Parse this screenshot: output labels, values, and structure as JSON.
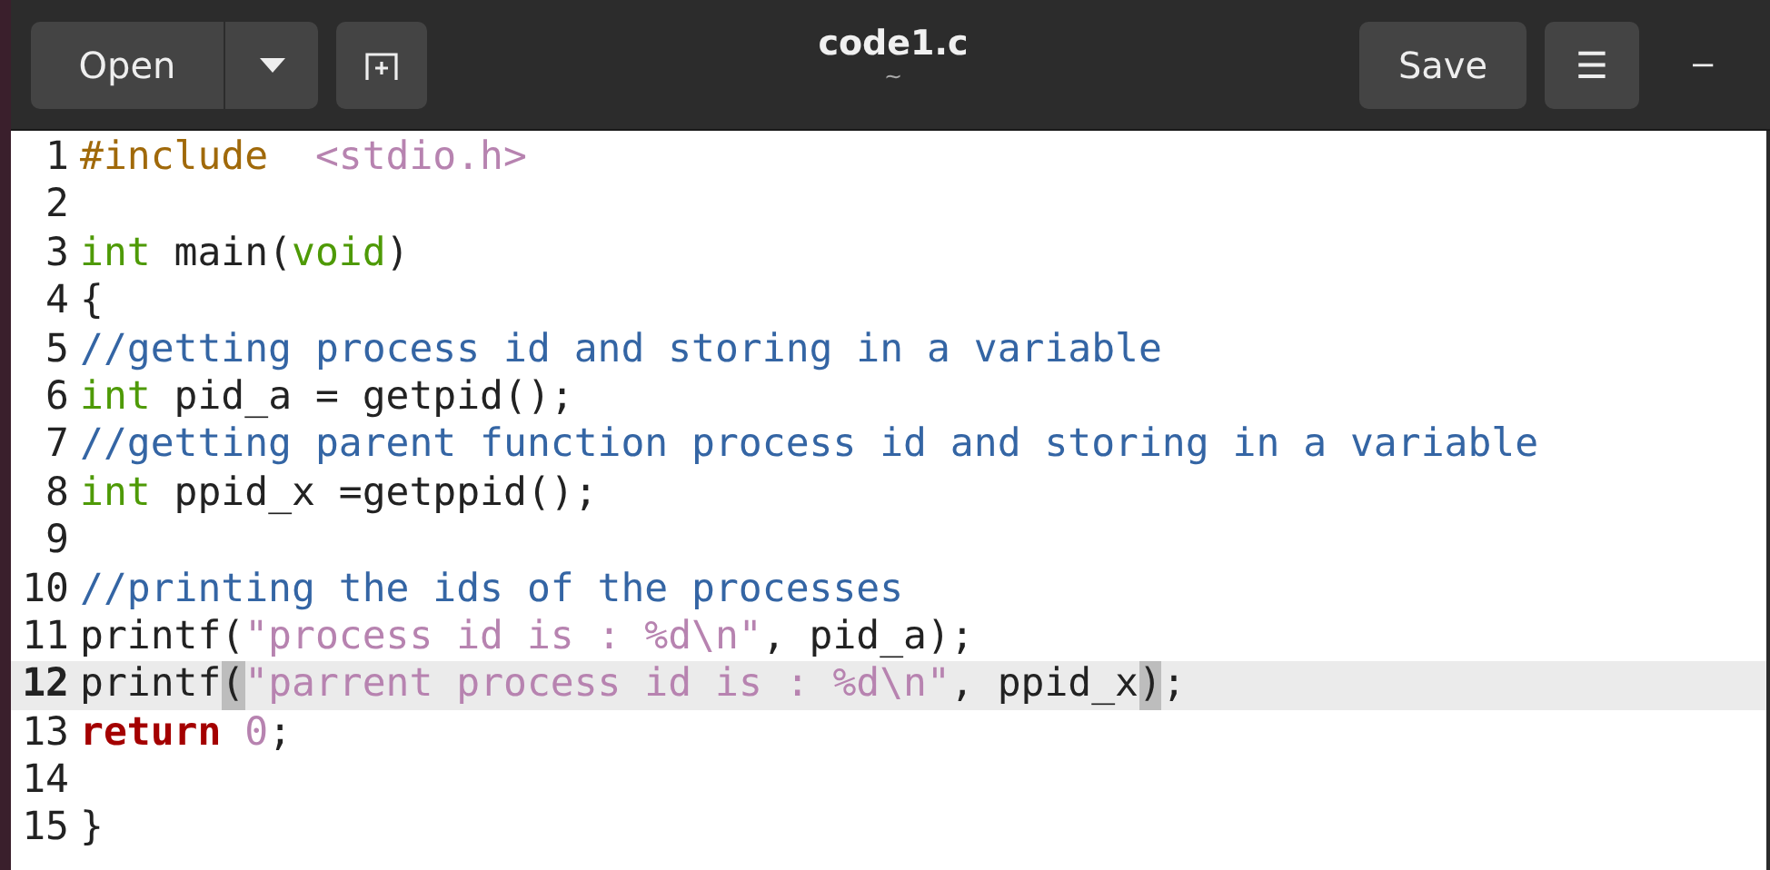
{
  "header": {
    "open_button": "Open",
    "title": "code1.c",
    "subtitle": "~",
    "save_button": "Save",
    "menu_button": "☰",
    "minimize_button": "–"
  },
  "lines": [
    {
      "number": "1",
      "current": false,
      "tokens": [
        {
          "kind": "preproc",
          "text": "#include  "
        },
        {
          "kind": "string",
          "text": "<stdio.h>"
        }
      ]
    },
    {
      "number": "2",
      "current": false
    },
    {
      "number": "3",
      "current": false,
      "tokens": [
        {
          "kind": "type",
          "text": "int"
        },
        {
          "kind": "plain",
          "text": " main("
        },
        {
          "kind": "type",
          "text": "void"
        },
        {
          "kind": "plain",
          "text": ")"
        }
      ]
    },
    {
      "number": "4",
      "current": false,
      "tokens": [
        {
          "kind": "plain",
          "text": "{"
        }
      ]
    },
    {
      "number": "5",
      "current": false,
      "tokens": [
        {
          "kind": "comment",
          "text": "//getting process id and storing in a variable"
        }
      ]
    },
    {
      "number": "6",
      "current": false,
      "tokens": [
        {
          "kind": "type",
          "text": "int"
        },
        {
          "kind": "plain",
          "text": " pid_a = getpid();"
        }
      ]
    },
    {
      "number": "7",
      "current": false,
      "tokens": [
        {
          "kind": "comment",
          "text": "//getting parent function process id and storing in a variable"
        }
      ]
    },
    {
      "number": "8",
      "current": false,
      "tokens": [
        {
          "kind": "type",
          "text": "int"
        },
        {
          "kind": "plain",
          "text": " ppid_x =getppid();"
        }
      ]
    },
    {
      "number": "9",
      "current": false
    },
    {
      "number": "10",
      "current": false,
      "tokens": [
        {
          "kind": "comment",
          "text": "//printing the ids of the processes"
        }
      ]
    },
    {
      "number": "11",
      "current": false,
      "tokens": [
        {
          "kind": "plain",
          "text": "printf("
        },
        {
          "kind": "string",
          "text": "\"process id is : %d\\n\""
        },
        {
          "kind": "plain",
          "text": ", pid_a);"
        }
      ]
    },
    {
      "number": "12",
      "current": true,
      "tokens": [
        {
          "kind": "plain",
          "text": "printf"
        },
        {
          "kind": "match",
          "text": "("
        },
        {
          "kind": "string",
          "text": "\"parrent process id is : %d\\n\""
        },
        {
          "kind": "plain",
          "text": ", ppid_x"
        },
        {
          "kind": "match",
          "text": ")",
          "cursor": true
        },
        {
          "kind": "plain",
          "text": ";"
        }
      ]
    },
    {
      "number": "13",
      "current": false,
      "tokens": [
        {
          "kind": "keyword",
          "text": "return"
        },
        {
          "kind": "number",
          "text": " 0"
        },
        {
          "kind": "plain",
          "text": ";"
        }
      ]
    },
    {
      "number": "14",
      "current": false
    },
    {
      "number": "15",
      "current": false,
      "tokens": [
        {
          "kind": "plain",
          "text": "}"
        }
      ]
    }
  ]
}
